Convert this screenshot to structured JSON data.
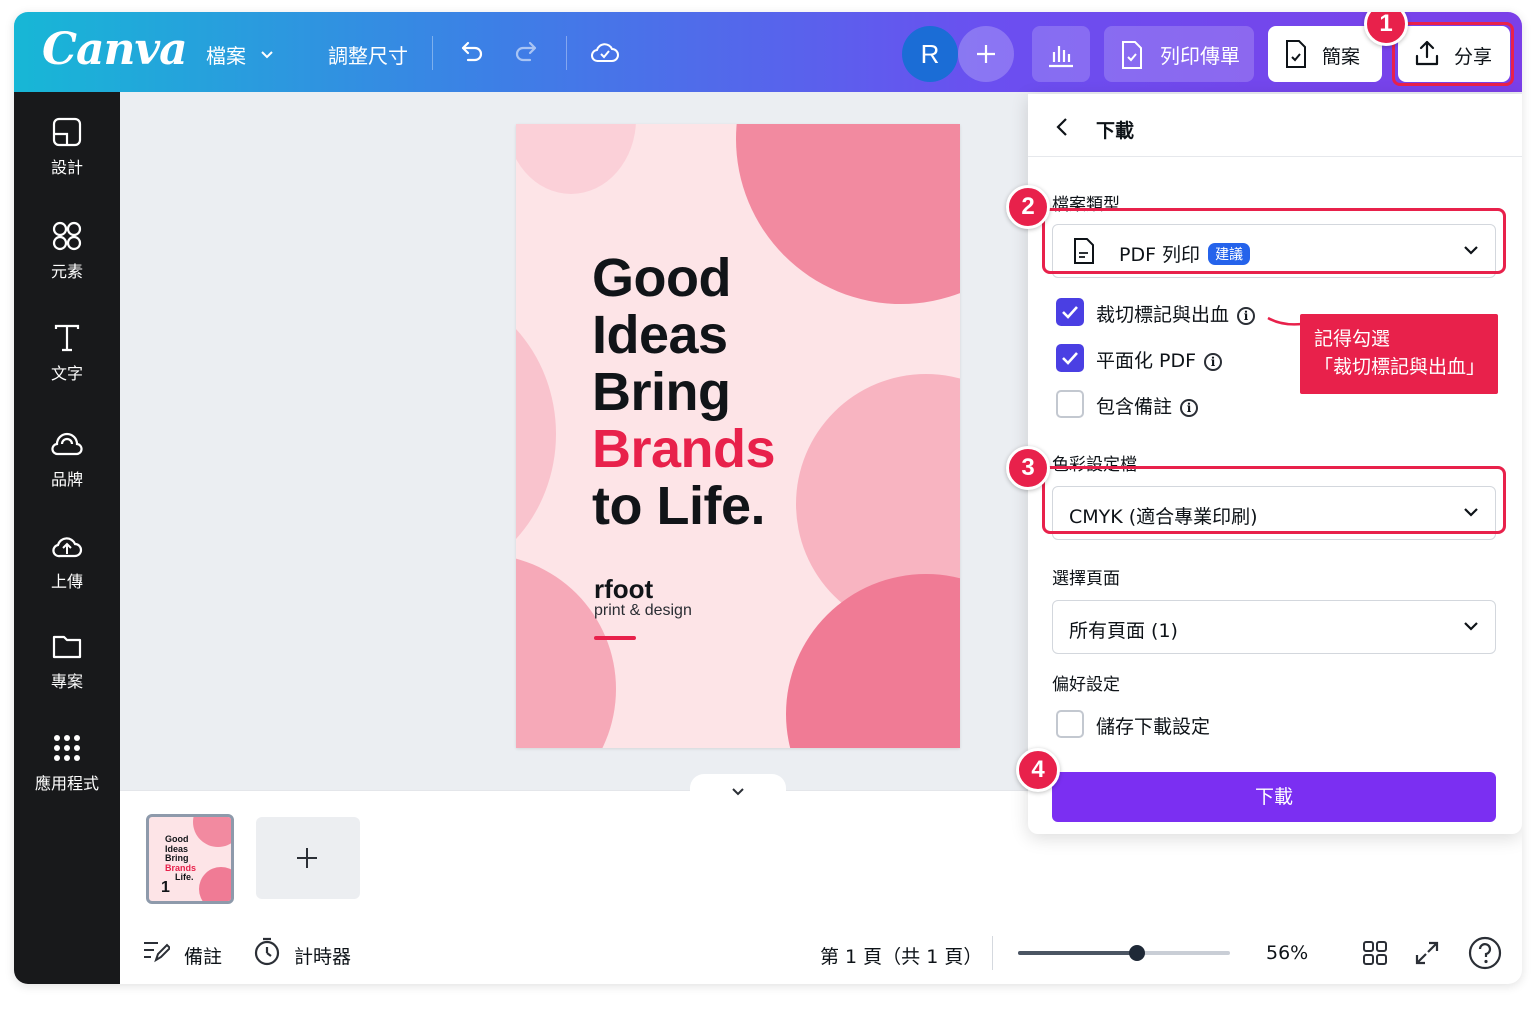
{
  "brand": {
    "logo": "Canva"
  },
  "header": {
    "file_menu": "檔案",
    "resize": "調整尺寸",
    "avatar_letter": "R",
    "print_flyer": "列印傳單",
    "present": "簡案",
    "share": "分享"
  },
  "sidebar": {
    "items": [
      {
        "label": "設計",
        "icon": "design-icon"
      },
      {
        "label": "元素",
        "icon": "elements-icon"
      },
      {
        "label": "文字",
        "icon": "text-icon"
      },
      {
        "label": "品牌",
        "icon": "brand-icon"
      },
      {
        "label": "上傳",
        "icon": "upload-icon"
      },
      {
        "label": "專案",
        "icon": "folder-icon"
      },
      {
        "label": "應用程式",
        "icon": "apps-icon"
      }
    ]
  },
  "poster": {
    "lines": [
      "Good",
      "Ideas",
      "Bring",
      "Brands",
      "to Life."
    ],
    "brand_name": "rfoot",
    "brand_sub": "print & design",
    "accent_color": "#e8214b"
  },
  "thumbnail": {
    "lines": [
      "Good",
      "Ideas",
      "Bring",
      "Brands",
      "Life."
    ],
    "page_number": "1"
  },
  "bottom_bar": {
    "notes": "備註",
    "timer": "計時器",
    "page_info": "第 1 頁（共 1 頁）",
    "zoom": "56%",
    "zoom_level": 0.56
  },
  "download_panel": {
    "title": "下載",
    "file_type_label": "檔案類型",
    "file_type_value": "PDF 列印",
    "file_type_badge": "建議",
    "options": [
      {
        "label": "裁切標記與出血",
        "checked": true
      },
      {
        "label": "平面化 PDF",
        "checked": true
      },
      {
        "label": "包含備註",
        "checked": false
      }
    ],
    "color_profile_label": "色彩設定檔",
    "color_profile_value": "CMYK (適合專業印刷)",
    "pages_label": "選擇頁面",
    "pages_value": "所有頁面 (1)",
    "preferences_label": "偏好設定",
    "save_settings": "儲存下載設定",
    "save_settings_checked": false,
    "download_button": "下載"
  },
  "callout": {
    "line1": "記得勾選",
    "line2": "「裁切標記與出血」"
  },
  "steps": [
    "1",
    "2",
    "3",
    "4"
  ],
  "colors": {
    "highlight": "#e8214b",
    "download_button": "#7b2ff2",
    "checkbox": "#4a3fe3",
    "badge": "#2563eb"
  }
}
